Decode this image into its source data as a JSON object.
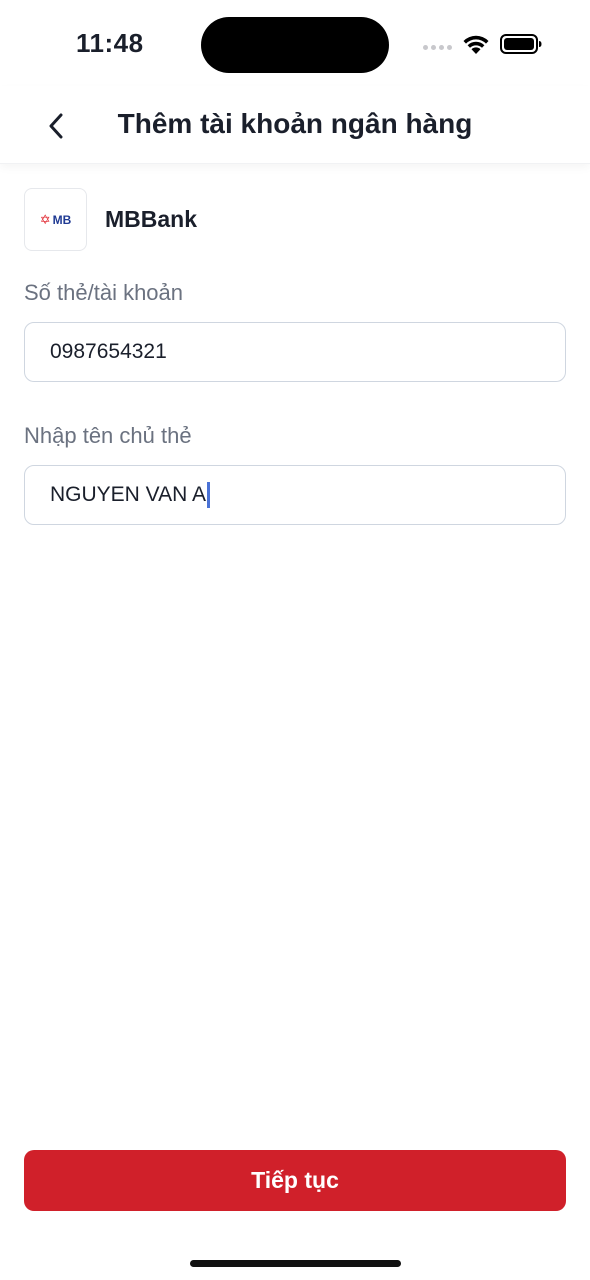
{
  "status_bar": {
    "time": "11:48"
  },
  "header": {
    "title": "Thêm tài khoản ngân hàng"
  },
  "bank": {
    "name": "MBBank",
    "logo_text": "MB",
    "logo_star": "✡",
    "brand_color": "#1f3a93",
    "accent_color": "#e0242d"
  },
  "form": {
    "account_label": "Số thẻ/tài khoản",
    "account_value": "0987654321",
    "holder_label": "Nhập tên chủ thẻ",
    "holder_value": "NGUYEN VAN A"
  },
  "actions": {
    "continue_label": "Tiếp tục",
    "continue_color": "#d0202a"
  }
}
